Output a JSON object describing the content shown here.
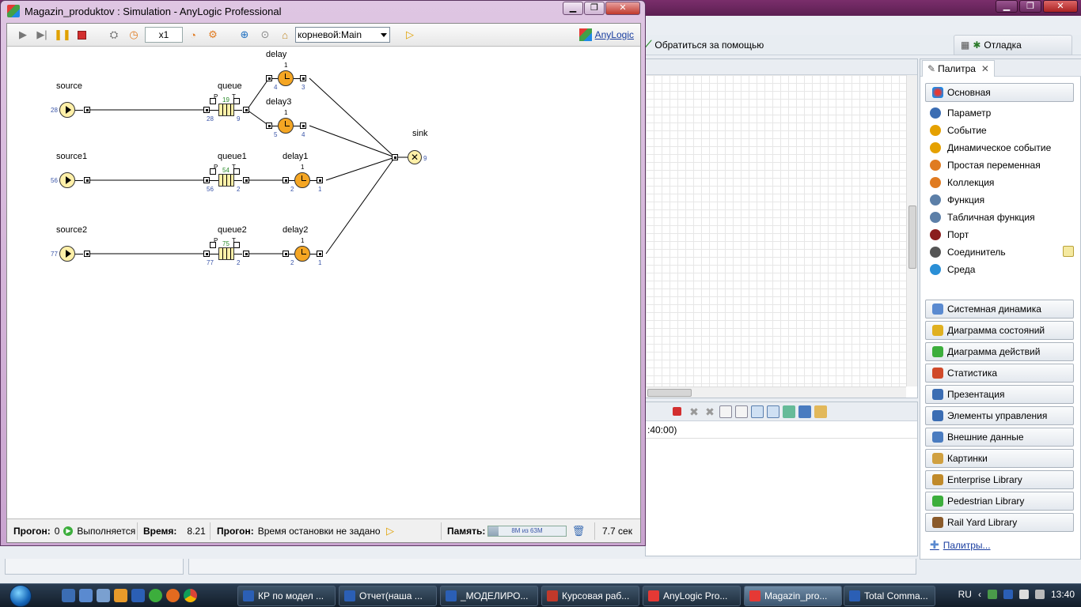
{
  "background_ide": {
    "help_link": "Обратиться за помощью",
    "debug_tab": "Отладка",
    "console_line": ":40:00)"
  },
  "palette": {
    "tab": "Палитра",
    "main_category": "Основная",
    "items": [
      {
        "label": "Параметр",
        "icon": "parameter-icon",
        "color": "#3b6db3"
      },
      {
        "label": "Событие",
        "icon": "event-icon",
        "color": "#e5a100"
      },
      {
        "label": "Динамическое событие",
        "icon": "dynamic-event-icon",
        "color": "#e5a100"
      },
      {
        "label": "Простая переменная",
        "icon": "variable-icon",
        "color": "#e07b21"
      },
      {
        "label": "Коллекция",
        "icon": "collection-icon",
        "color": "#e07b21"
      },
      {
        "label": "Функция",
        "icon": "function-icon",
        "color": "#5c7fa8"
      },
      {
        "label": "Табличная функция",
        "icon": "table-function-icon",
        "color": "#5c7fa8"
      },
      {
        "label": "Порт",
        "icon": "port-icon",
        "color": "#8a1d1d"
      },
      {
        "label": "Соединитель",
        "icon": "connector-icon",
        "color": "#555555"
      },
      {
        "label": "Среда",
        "icon": "environment-icon",
        "color": "#2a8fd6"
      }
    ],
    "categories": [
      "Системная динамика",
      "Диаграмма состояний",
      "Диаграмма действий",
      "Статистика",
      "Презентация",
      "Элементы управления",
      "Внешние данные",
      "Картинки",
      "Enterprise Library",
      "Pedestrian Library",
      "Rail Yard Library"
    ],
    "more_link": "Палитры..."
  },
  "sim": {
    "title": "Magazin_produktov : Simulation - AnyLogic Professional",
    "speed": "x1",
    "agent_select": "корневой:Main",
    "brand": "AnyLogic",
    "blocks": {
      "source": {
        "name": "source",
        "count": "28"
      },
      "source1": {
        "name": "source1",
        "count": "56"
      },
      "source2": {
        "name": "source2",
        "count": "77"
      },
      "queue": {
        "name": "queue",
        "in": "28",
        "out": "9",
        "size": "19",
        "p": "P",
        "t": "T"
      },
      "queue1": {
        "name": "queue1",
        "in": "56",
        "out": "2",
        "size": "54",
        "p": "P",
        "t": "T"
      },
      "queue2": {
        "name": "queue2",
        "in": "77",
        "out": "2",
        "size": "75",
        "p": "P",
        "t": "T"
      },
      "delay": {
        "name": "delay",
        "in": "4",
        "out": "3",
        "count": "1"
      },
      "delay3": {
        "name": "delay3",
        "in": "5",
        "out": "4",
        "count": "1"
      },
      "delay1": {
        "name": "delay1",
        "in": "2",
        "out": "1",
        "count": "1"
      },
      "delay2": {
        "name": "delay2",
        "in": "2",
        "out": "1",
        "count": "1"
      },
      "sink": {
        "name": "sink",
        "count": "9"
      }
    },
    "status": {
      "run_label": "Прогон:",
      "run_value": "0",
      "run_state": "Выполняется",
      "time_label": "Время:",
      "time_value": "8.21",
      "stop_label": "Прогон:",
      "stop_value": "Время остановки не задано",
      "memory_label": "Память:",
      "memory_text": "8M из 63M",
      "memory_fraction": 0.13,
      "elapsed": "7.7 сек"
    }
  },
  "taskbar": {
    "tasks": [
      {
        "label": "КР по модел ...",
        "color": "#2b5fb5"
      },
      {
        "label": "Отчет(наша ...",
        "color": "#2b5fb5"
      },
      {
        "label": "_МОДЕЛИРО...",
        "color": "#2b5fb5"
      },
      {
        "label": "Курсовая раб...",
        "color": "#c0392b"
      },
      {
        "label": "AnyLogic Pro...",
        "color": "#e53935"
      },
      {
        "label": "Magazin_pro...",
        "color": "#e53935"
      },
      {
        "label": "Total Comma...",
        "color": "#2b5fb5"
      }
    ],
    "lang": "RU",
    "clock": "13:40"
  }
}
